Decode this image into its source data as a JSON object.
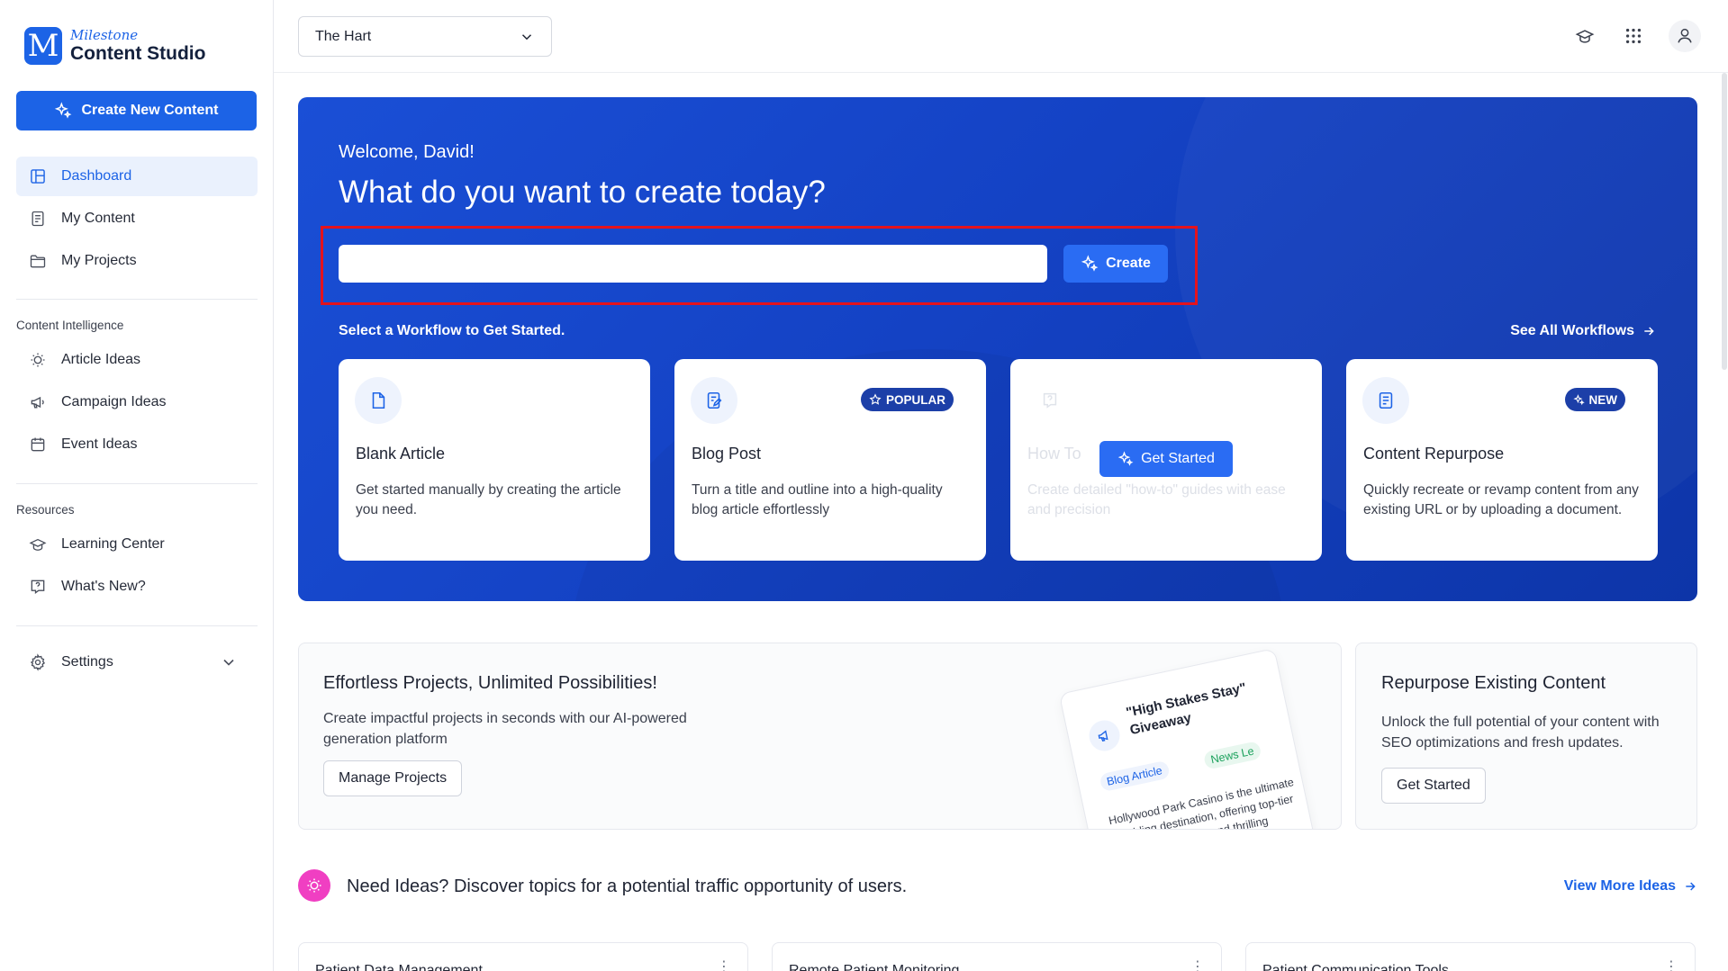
{
  "app": {
    "logo_top": "Milestone",
    "logo_bottom": "Content Studio",
    "logo_letter": "M",
    "brand_color": "#1c63e6"
  },
  "sidebar": {
    "create_label": "Create New Content",
    "main_items": [
      {
        "label": "Dashboard",
        "icon": "layout-icon",
        "active": true
      },
      {
        "label": "My Content",
        "icon": "document-icon"
      },
      {
        "label": "My Projects",
        "icon": "folder-icon"
      }
    ],
    "intelligence_label": "Content Intelligence",
    "intelligence_items": [
      {
        "label": "Article Ideas",
        "icon": "lightbulb-icon"
      },
      {
        "label": "Campaign Ideas",
        "icon": "megaphone-icon"
      },
      {
        "label": "Event Ideas",
        "icon": "calendar-icon"
      }
    ],
    "resources_label": "Resources",
    "resources_items": [
      {
        "label": "Learning Center",
        "icon": "graduation-cap-icon"
      },
      {
        "label": "What's New?",
        "icon": "question-icon"
      }
    ],
    "settings_label": "Settings"
  },
  "topbar": {
    "site_selected": "The Hart"
  },
  "hero": {
    "welcome": "Welcome, David!",
    "title": "What do you want to create today?",
    "input_value": "",
    "create_label": "Create",
    "workflow_label": "Select a Workflow to Get Started.",
    "see_all_label": "See All Workflows"
  },
  "workflows": [
    {
      "title": "Blank Article",
      "desc": "Get started manually by creating the article you need.",
      "icon": "file-icon"
    },
    {
      "title": "Blog Post",
      "desc": "Turn a title and outline into a high-quality blog article effortlessly",
      "icon": "edit-document-icon",
      "badge": "POPULAR"
    },
    {
      "title": "How To",
      "desc": "Create detailed \"how-to\" guides with ease and precision",
      "icon": "question-icon",
      "hover_button": "Get Started"
    },
    {
      "title": "Content Repurpose",
      "desc": "Quickly recreate or revamp content from any existing URL or by uploading a document.",
      "icon": "document-icon",
      "badge": "NEW"
    }
  ],
  "promos": {
    "projects": {
      "title": "Effortless Projects, Unlimited Possibilities!",
      "desc": "Create impactful projects in seconds with our AI-powered generation platform",
      "button": "Manage Projects",
      "preview": {
        "title": "\"High Stakes Stay\" Giveaway",
        "tag1": "Blog Article",
        "tag2": "News Le",
        "body": "Hollywood Park Casino is the ultimate gambling destination, offering top-tier poker, table games and thrilling casino"
      }
    },
    "repurpose": {
      "title": "Repurpose Existing Content",
      "desc": "Unlock the full potential of your content with SEO optimizations and fresh updates.",
      "button": "Get Started"
    }
  },
  "ideas": {
    "title": "Need Ideas? Discover topics for a potential traffic opportunity of users.",
    "view_more": "View More Ideas",
    "cards": [
      {
        "title": "Patient Data Management"
      },
      {
        "title": "Remote Patient Monitoring"
      },
      {
        "title": "Patient Communication Tools"
      }
    ]
  }
}
